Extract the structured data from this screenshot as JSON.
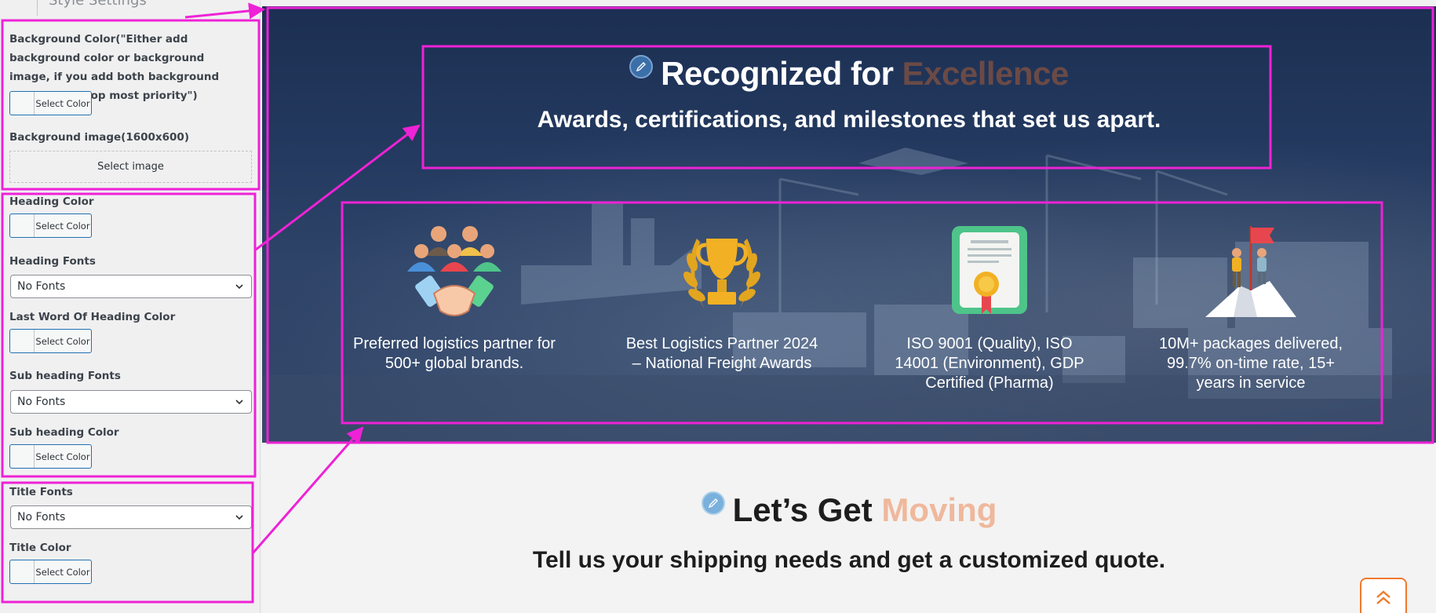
{
  "sidebar": {
    "section_title": "Style Settings",
    "bg_color_label": "Background Color(\"Either add background color or background image, if you add both background color will be top most priority\")",
    "bg_color_btn": "Select Color",
    "bg_image_label": "Background image(1600x600)",
    "bg_image_btn": "Select image",
    "heading_color_label": "Heading Color",
    "heading_color_btn": "Select Color",
    "heading_fonts_label": "Heading Fonts",
    "heading_fonts_value": "No Fonts",
    "last_word_color_label": "Last Word Of Heading Color",
    "last_word_color_btn": "Select Color",
    "sub_heading_fonts_label": "Sub heading Fonts",
    "sub_heading_fonts_value": "No Fonts",
    "sub_heading_color_label": "Sub heading Color",
    "sub_heading_color_btn": "Select Color",
    "title_fonts_label": "Title Fonts",
    "title_fonts_value": "No Fonts",
    "title_color_label": "Title Color",
    "title_color_btn": "Select Color"
  },
  "hero": {
    "heading_main": "Recognized for ",
    "heading_last": "Excellence",
    "subheading": "Awards, certifications, and milestones that set us apart.",
    "awards": [
      {
        "icon": "handshake-team-icon",
        "text": "Preferred logistics partner for 500+ global brands."
      },
      {
        "icon": "trophy-icon",
        "text": "Best Logistics Partner 2024 – National Freight Awards"
      },
      {
        "icon": "certificate-icon",
        "text": "ISO 9001 (Quality), ISO 14001 (Environment), GDP Certified (Pharma)"
      },
      {
        "icon": "summit-flag-icon",
        "text": "10M+ packages delivered, 99.7% on-time rate, 15+ years in service"
      }
    ]
  },
  "contact": {
    "heading_main": "Let’s Get ",
    "heading_last": "Moving",
    "subheading": "Tell us your shipping needs and get a customized quote."
  },
  "colors": {
    "annotation": "#ee22d6",
    "hero_last_word": "#6b4a46",
    "contact_last_word": "#efb89c",
    "scroll_top_border": "#f07a2f"
  }
}
